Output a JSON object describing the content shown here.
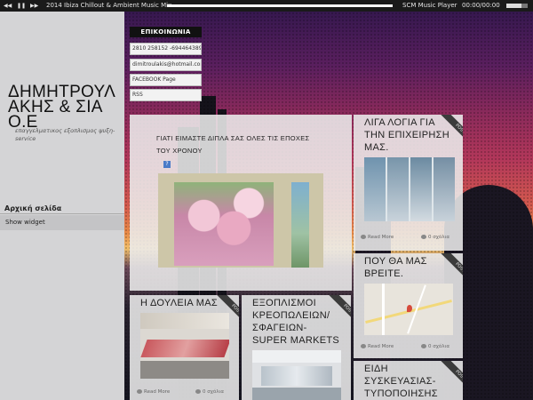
{
  "player": {
    "prev_icon": "prev-icon",
    "pause_icon": "pause-icon",
    "next_icon": "next-icon",
    "title": "2014 Ibiza Chillout & Ambient Music Mix",
    "progress": 0.0,
    "brand": "SCM Music Player",
    "time": "00:00/00:00",
    "volume": 0.7
  },
  "sidebar": {
    "site_title": "ΔΗΜΗΤΡΟΥΛΑΚΗΣ & ΣΙΑ Ο.Ε",
    "tagline": "επαγγελματικος εξοπλισμος ψυξη-service",
    "home_label": "Αρχική σελίδα",
    "show_widget": "Show widget"
  },
  "contact": {
    "heading": "ΕΠΙΚΟΙΝΩΝΙΑ",
    "items": [
      "2810 258152 -6944643896",
      "dimitroulakis@hotmail.com",
      "FACEBOOK Page",
      "RSS"
    ]
  },
  "cards": {
    "main": {
      "title": "ΓΙΑΤΙ ΕΙΜΑΣΤΕ ΔΙΠΛΑ ΣΑΣ ΟΛΕΣ ΤΙΣ ΕΠΟΧΕΣ ΤΟΥ ΧΡΟΝΟΥ",
      "badge": "?"
    },
    "about": {
      "title": "ΛΙΓΑ ΛΟΓΙΑ ΓΙΑ ΤΗΝ ΕΠΙΧΕΙΡΗΣΗ ΜΑΣ.",
      "read_more": "Read More",
      "comments": "0 σχόλια",
      "ribbon": "POST"
    },
    "where": {
      "title": "ΠΟΥ ΘΑ ΜΑΣ ΒΡΕΙΤΕ.",
      "read_more": "Read More",
      "comments": "0 σχόλια",
      "ribbon": "POST"
    },
    "work": {
      "title": "Η ΔΟΥΛΕΙΑ ΜΑΣ",
      "read_more": "Read More",
      "comments": "0 σχόλια",
      "ribbon": "POST"
    },
    "equipment": {
      "title": "ΕΞΟΠΛΙΣΜΟΙ ΚΡΕΟΠΩΛΕΙΩΝ/ ΣΦΑΓΕΙΩΝ-SUPER MARKETS",
      "ribbon": "POST"
    },
    "packaging": {
      "title": "ΕΙΔΗ ΣΥΣΚΕΥΑΣΙΑΣ-ΤΥΠΟΠΟΙΗΣΗΣ",
      "ribbon": "POST"
    }
  },
  "colors": {
    "sidebar": "#d4d4d6",
    "card": "#ececec",
    "ribbon": "#3b3b3b",
    "header_dark": "#111111"
  }
}
